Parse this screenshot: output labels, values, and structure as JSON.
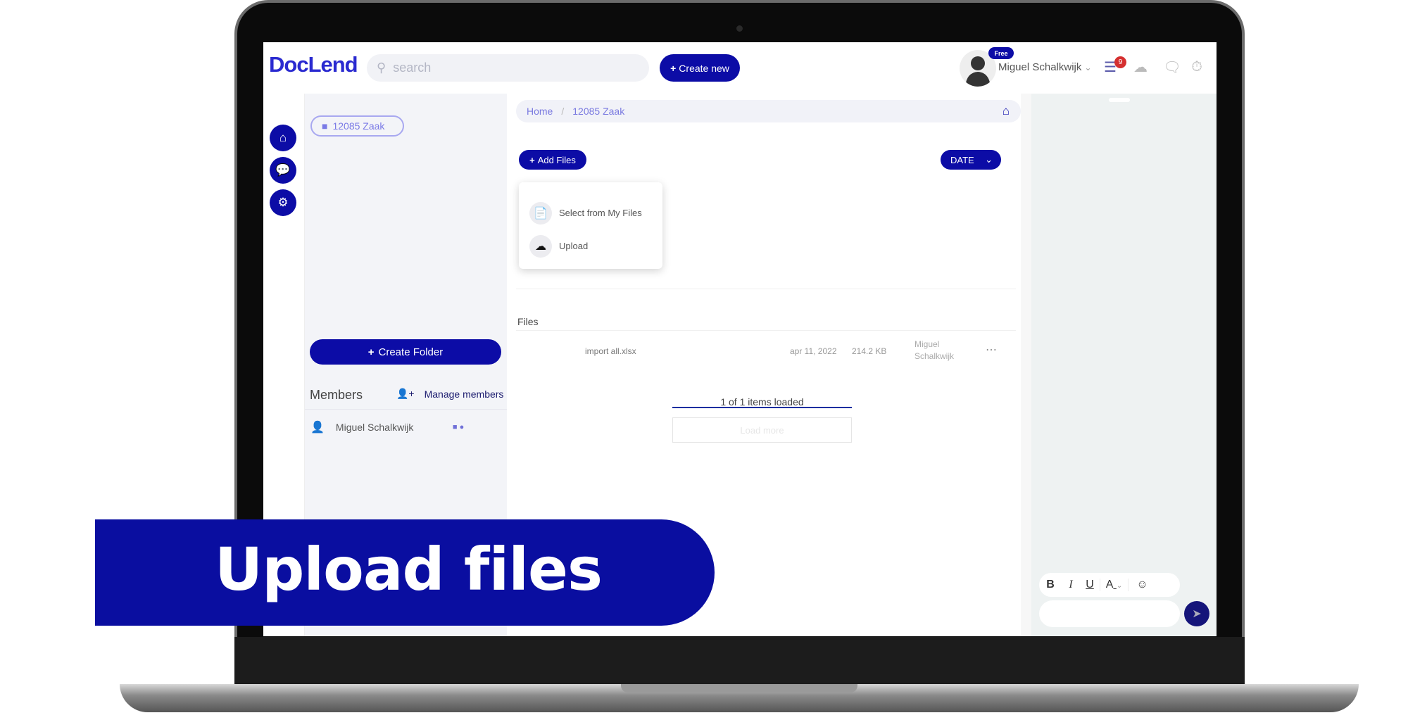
{
  "header": {
    "logo": "DocLend",
    "search_placeholder": "search",
    "create_new": "Create new",
    "plan_badge": "Free",
    "user_name": "Miguel Schalkwijk",
    "notification_count": "9"
  },
  "rail": {
    "items": [
      {
        "icon": "home-icon"
      },
      {
        "icon": "chat-icon"
      },
      {
        "icon": "gear-icon"
      }
    ]
  },
  "left_panel": {
    "folder": "12085 Zaak",
    "create_folder": "Create Folder",
    "members_label": "Members",
    "manage_members": "Manage members",
    "members": [
      {
        "name": "Miguel Schalkwijk"
      }
    ]
  },
  "main": {
    "breadcrumb": [
      "Home",
      "/",
      "12085 Zaak"
    ],
    "add_files": "Add Files",
    "sort": "DATE",
    "dropdown": [
      "Select from My Files",
      "Upload"
    ],
    "files_label": "Files",
    "files": [
      {
        "name": "import all.xlsx",
        "date": "apr 11, 2022",
        "size": "214.2 KB",
        "owner": "Miguel Schalkwijk"
      }
    ],
    "loaded": "1 of 1 items loaded",
    "loaded_progress": 1.0,
    "load_more": "Load more"
  },
  "chat": {
    "toolbar": [
      "B",
      "I",
      "U",
      "A"
    ]
  },
  "banner": {
    "text": "Upload files"
  },
  "colors": {
    "brand": "#0c0ca6",
    "badge": "#d53030",
    "excel": "#3cae4e"
  }
}
